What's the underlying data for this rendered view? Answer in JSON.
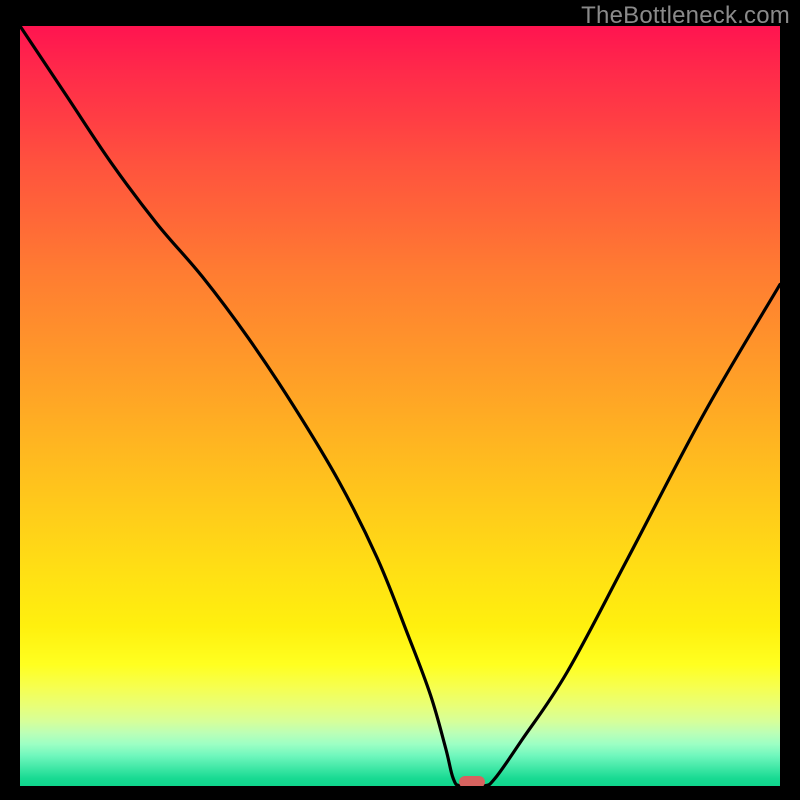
{
  "watermark": "TheBottleneck.com",
  "chart_data": {
    "type": "line",
    "title": "",
    "xlabel": "",
    "ylabel": "",
    "xlim": [
      0,
      100
    ],
    "ylim": [
      0,
      100
    ],
    "series": [
      {
        "name": "curve",
        "x": [
          0,
          6,
          12,
          18,
          24,
          30,
          36,
          42,
          47,
          51,
          54,
          56,
          57,
          58,
          61,
          62.5,
          66,
          72,
          80,
          90,
          100
        ],
        "values": [
          100,
          91,
          82,
          74,
          67,
          59,
          50,
          40,
          30,
          20,
          12,
          5,
          1,
          0,
          0,
          1,
          6,
          15,
          30,
          49,
          66
        ]
      }
    ],
    "marker": {
      "x": 59.5,
      "y": 0.5
    },
    "colors": {
      "gradient_top": "#ff1450",
      "gradient_mid": "#ffe014",
      "gradient_bottom": "#0fd58c",
      "curve": "#000000",
      "marker": "#d6625f",
      "frame": "#000000"
    }
  }
}
